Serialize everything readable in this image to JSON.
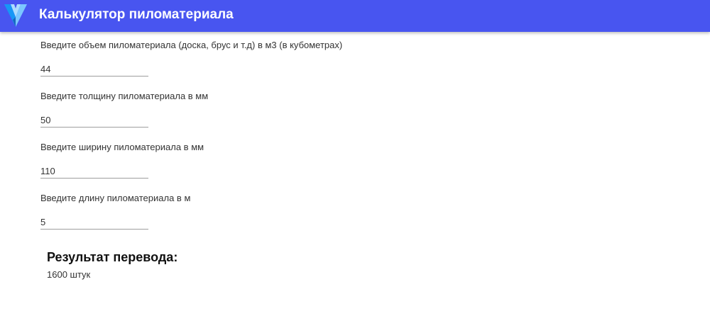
{
  "header": {
    "title": "Калькулятор пиломатериала",
    "logo_icon": "vuetify-logo-icon",
    "background_color": "#4855f0"
  },
  "form": {
    "fields": [
      {
        "label": "Введите объем пиломатериала (доска, брус и т.д) в м3 (в кубометрах)",
        "value": "44"
      },
      {
        "label": "Введите толщину пиломатериала в мм",
        "value": "50"
      },
      {
        "label": "Введите ширину пиломатериала в мм",
        "value": "110"
      },
      {
        "label": "Введите длину пиломатериала в м",
        "value": "5"
      }
    ]
  },
  "result": {
    "title": "Результат перевода:",
    "value": "1600 штук"
  }
}
